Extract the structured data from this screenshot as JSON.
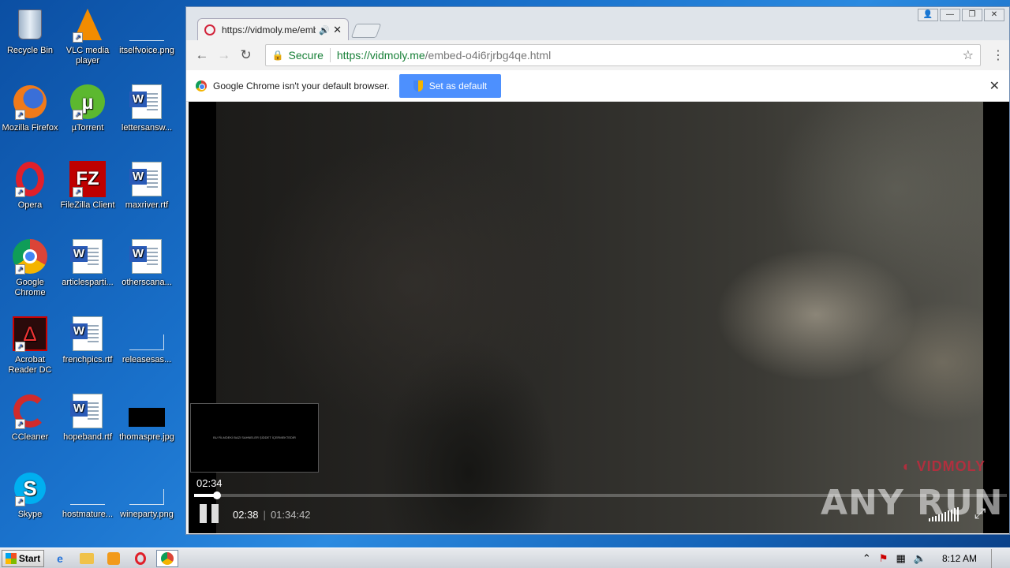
{
  "desktop": {
    "icons": [
      {
        "label": "Recycle Bin"
      },
      {
        "label": "VLC media player"
      },
      {
        "label": "itselfvoice.png"
      },
      {
        "label": "Mozilla Firefox"
      },
      {
        "label": "µTorrent"
      },
      {
        "label": "lettersansw..."
      },
      {
        "label": "Opera"
      },
      {
        "label": "FileZilla Client"
      },
      {
        "label": "maxriver.rtf"
      },
      {
        "label": "Google Chrome"
      },
      {
        "label": "articlesparti..."
      },
      {
        "label": "otherscana..."
      },
      {
        "label": "Acrobat Reader DC"
      },
      {
        "label": "frenchpics.rtf"
      },
      {
        "label": "releasesas..."
      },
      {
        "label": "CCleaner"
      },
      {
        "label": "hopeband.rtf"
      },
      {
        "label": "thomaspre.jpg"
      },
      {
        "label": "Skype"
      },
      {
        "label": "hostmature..."
      },
      {
        "label": "wineparty.png"
      }
    ]
  },
  "browser": {
    "tab_title": "https://vidmoly.me/emb",
    "omnibox": {
      "secure_label": "Secure",
      "url_scheme_host": "https://vidmoly.me",
      "url_path": "/embed-o4i6rjrbg4qe.html"
    },
    "infobar": {
      "message": "Google Chrome isn't your default browser.",
      "button": "Set as default"
    }
  },
  "player": {
    "hover_time": "02:34",
    "current_time": "02:38",
    "separator": "|",
    "duration": "01:34:42",
    "progress": 0.028,
    "watermark": "VIDMOLY",
    "preview_text": "BU FİLMDEKİ BAZI SAHNELER ŞİDDET İÇERMEKTEDİR"
  },
  "overlay_logo": "ANY RUN",
  "taskbar": {
    "start_label": "Start",
    "clock": "8:12 AM"
  },
  "colors": {
    "secure_green": "#188038",
    "infobar_button": "#4d90fe",
    "vidmoly_red": "#c8283c"
  }
}
